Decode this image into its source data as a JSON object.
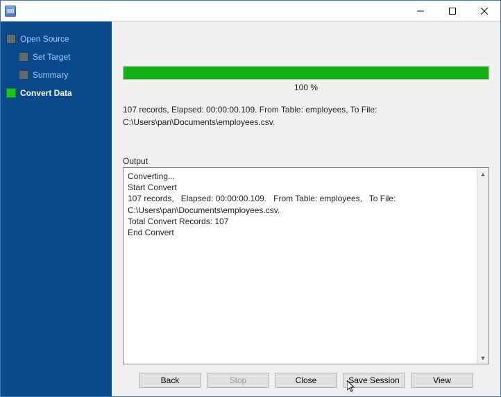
{
  "titlebar": {
    "title": ""
  },
  "sidebar": {
    "steps": [
      {
        "label": "Open Source"
      },
      {
        "label": "Set Target"
      },
      {
        "label": "Summary"
      },
      {
        "label": "Convert Data"
      }
    ]
  },
  "progress": {
    "percent": 100,
    "label": "100 %"
  },
  "summary_text": "107 records,   Elapsed: 00:00:00.109.   From Table: employees,   To File: C:\\Users\\pan\\Documents\\employees.csv.",
  "output": {
    "label": "Output",
    "lines": [
      "Converting...",
      "Start Convert",
      "107 records,   Elapsed: 00:00:00.109.   From Table: employees,   To File: C:\\Users\\pan\\Documents\\employees.csv.",
      "Total Convert Records: 107",
      "End Convert"
    ]
  },
  "buttons": {
    "back": "Back",
    "stop": "Stop",
    "close": "Close",
    "save_session": "Save Session",
    "view": "View"
  }
}
